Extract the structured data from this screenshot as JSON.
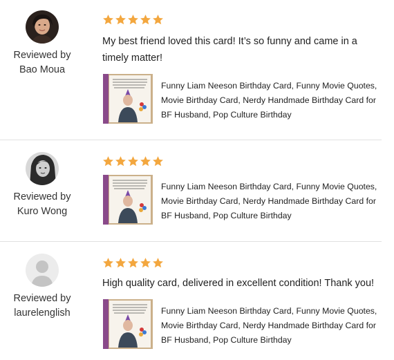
{
  "colors": {
    "star": "#f3a73f",
    "divider": "#e1e1e1",
    "text": "#222222"
  },
  "reviews": [
    {
      "reviewed_by_label": "Reviewed by",
      "reviewer": "Bao Moua",
      "rating": 5,
      "text": "My best friend loved this card! It’s so funny and came in a timely matter!",
      "item_title": "Funny Liam Neeson Birthday Card, Funny Movie Quotes, Movie Birthday Card, Nerdy Handmade Birthday Card for BF Husband, Pop Culture Birthday"
    },
    {
      "reviewed_by_label": "Reviewed by",
      "reviewer": "Kuro Wong",
      "rating": 5,
      "text": "",
      "item_title": "Funny Liam Neeson Birthday Card, Funny Movie Quotes, Movie Birthday Card, Nerdy Handmade Birthday Card for BF Husband, Pop Culture Birthday"
    },
    {
      "reviewed_by_label": "Reviewed by",
      "reviewer": "laurelenglish",
      "rating": 5,
      "text": "High quality card, delivered in excellent condition! Thank you!",
      "item_title": "Funny Liam Neeson Birthday Card, Funny Movie Quotes, Movie Birthday Card, Nerdy Handmade Birthday Card for BF Husband, Pop Culture Birthday"
    }
  ]
}
